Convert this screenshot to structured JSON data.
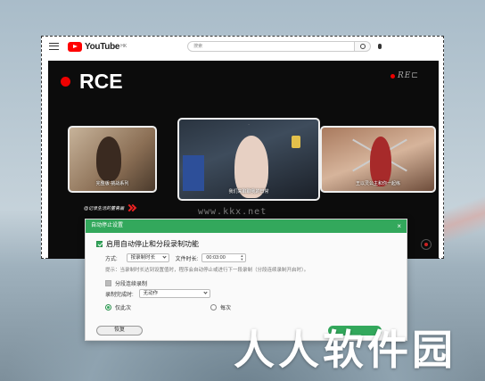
{
  "youtube": {
    "logo_text": "YouTube",
    "region": "HK",
    "search_placeholder": "搜索"
  },
  "video": {
    "rce_label": "RCE",
    "rec_mark": "RE⊏",
    "thumb1_caption": "完整版·挑战系列",
    "thumb2_top": "·",
    "thumb2_caption": "我们来聊聊我的日常",
    "thumb3_caption": "王以灵公主和你一起练",
    "channel_tag": "@记录生活的董青画",
    "watermark": "www.kkx.net"
  },
  "dialog": {
    "title": "自动停止设置",
    "close": "×",
    "enable_label": "启用自动停止和分段录制功能",
    "mode_label": "方式:",
    "mode_value": "按录制时长",
    "duration_label": "文件时长:",
    "duration_value": "00:03:00",
    "hint": "提示：当录制时长达到设置值时，程序会自动停止或进行下一段录制（分段连续录制开启时）。",
    "segment_label": "分段连续录制",
    "after_label": "录制完成时:",
    "after_value": "无动作",
    "once_label": "仅此次",
    "every_label": "每次",
    "restore_button": "恢复"
  },
  "overlay": {
    "site_watermark": "人人软件园"
  },
  "colors": {
    "accent": "#33a85c",
    "rec_red": "#e00000"
  }
}
